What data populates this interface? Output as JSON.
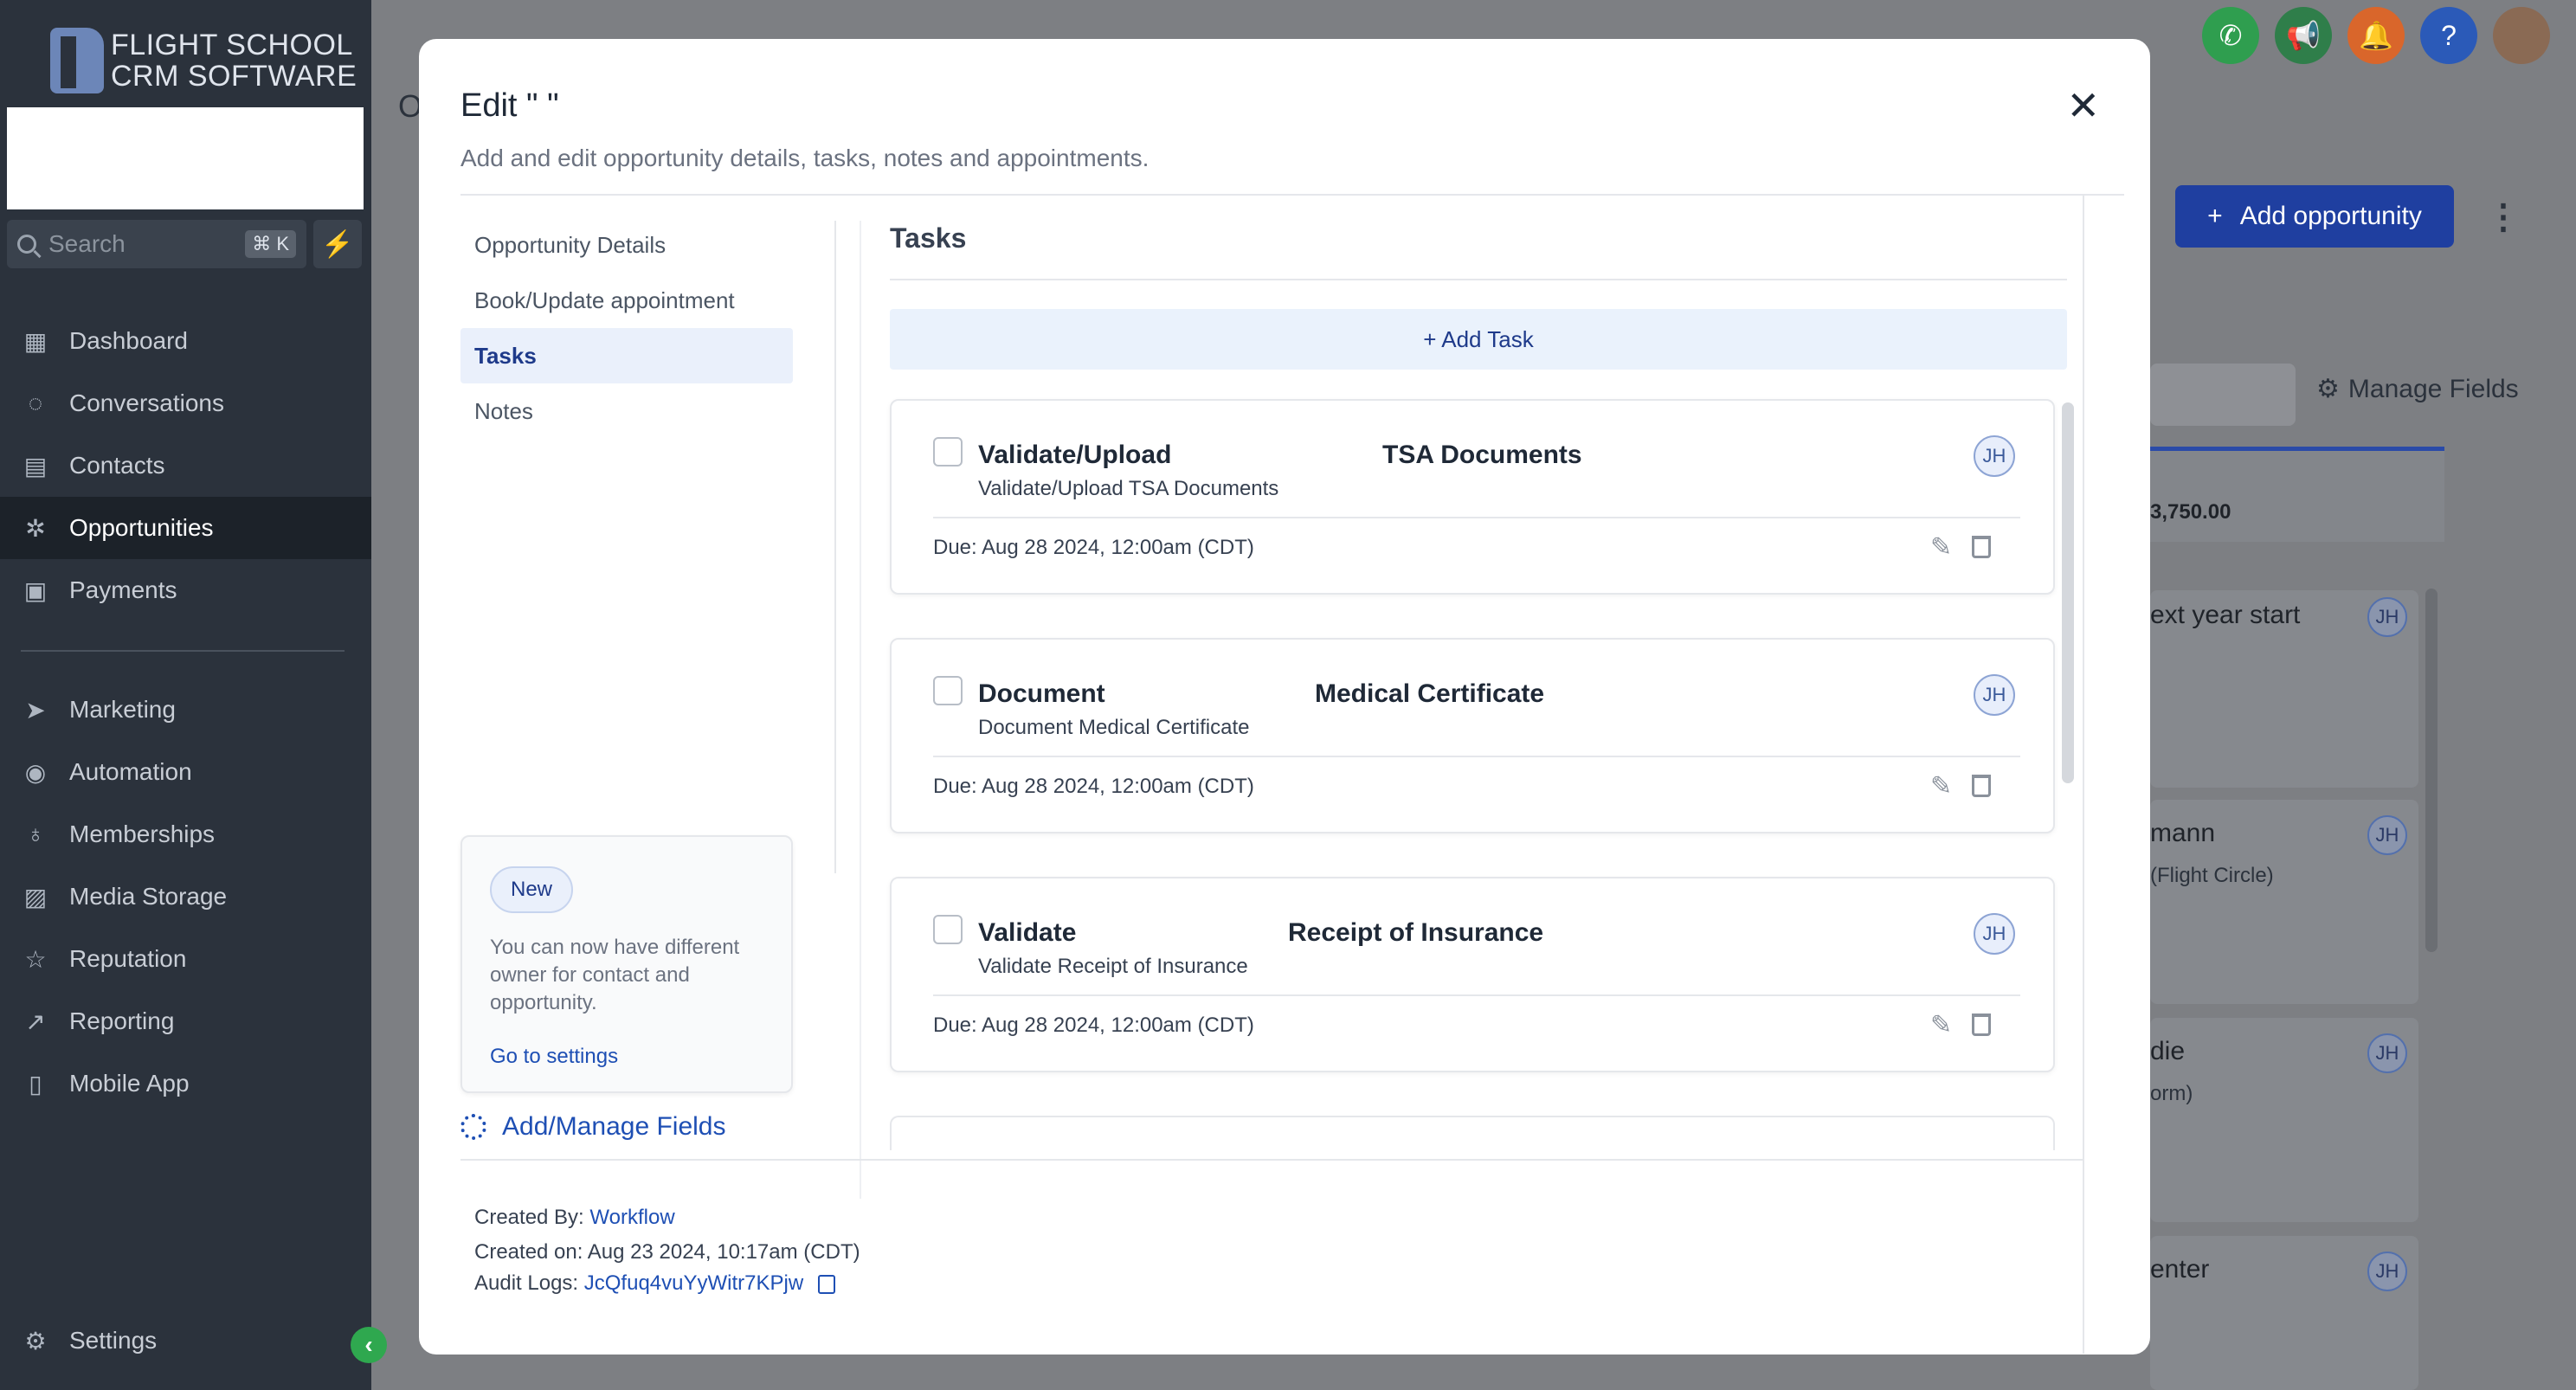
{
  "sidebar": {
    "logo_line1": "FLIGHT SCHOOL",
    "logo_line2": "CRM SOFTWARE",
    "search_placeholder": "Search",
    "search_shortcut": "⌘ K",
    "items": [
      {
        "label": "Dashboard",
        "icon": "dashboard-icon",
        "glyph": "▦"
      },
      {
        "label": "Conversations",
        "icon": "chat-icon",
        "glyph": "◌"
      },
      {
        "label": "Contacts",
        "icon": "contacts-icon",
        "glyph": "▤"
      },
      {
        "label": "Opportunities",
        "icon": "opportunities-icon",
        "glyph": "✲"
      },
      {
        "label": "Payments",
        "icon": "payments-icon",
        "glyph": "▣"
      },
      {
        "label": "Marketing",
        "icon": "send-icon",
        "glyph": "➤"
      },
      {
        "label": "Automation",
        "icon": "automation-icon",
        "glyph": "◉"
      },
      {
        "label": "Memberships",
        "icon": "membership-icon",
        "glyph": "♁"
      },
      {
        "label": "Media Storage",
        "icon": "image-icon",
        "glyph": "▨"
      },
      {
        "label": "Reputation",
        "icon": "star-icon",
        "glyph": "☆"
      },
      {
        "label": "Reporting",
        "icon": "trend-icon",
        "glyph": "↗"
      },
      {
        "label": "Mobile App",
        "icon": "phone-icon",
        "glyph": "▯"
      }
    ],
    "settings_label": "Settings"
  },
  "background": {
    "title_fragment": "O",
    "add_opportunity_label": "Add opportunity",
    "manage_fields_label": "Manage Fields",
    "amount": "3,750.00",
    "cards": [
      {
        "title": "ext year start",
        "sub": ""
      },
      {
        "title": "mann",
        "sub": "(Flight Circle)"
      },
      {
        "title": "die",
        "sub": "orm)"
      },
      {
        "title": "enter",
        "sub": ""
      }
    ],
    "avatar_initials": "JH"
  },
  "modal": {
    "title": "Edit \"                              \"",
    "subtitle": "Add and edit opportunity details, tasks, notes and appointments.",
    "close_glyph": "✕",
    "nav": [
      {
        "label": "Opportunity Details",
        "active": false
      },
      {
        "label": "Book/Update appointment",
        "active": false
      },
      {
        "label": "Tasks",
        "active": true
      },
      {
        "label": "Notes",
        "active": false
      }
    ],
    "promo": {
      "badge": "New",
      "text": "You can now have different owner for contact and opportunity.",
      "link": "Go to settings"
    },
    "add_manage_fields": "Add/Manage Fields",
    "tasks_heading": "Tasks",
    "add_task_label": "+ Add Task",
    "tasks": [
      {
        "title": "Validate/Upload",
        "title2": "TSA Documents",
        "desc": "Validate/Upload TSA Documents",
        "due": "Due: Aug 28 2024, 12:00am (CDT)",
        "assignee": "JH"
      },
      {
        "title": "Document",
        "title2": "Medical Certificate",
        "desc": "Document Medical Certificate",
        "due": "Due: Aug 28 2024, 12:00am (CDT)",
        "assignee": "JH"
      },
      {
        "title": "Validate",
        "title2": "Receipt of Insurance",
        "desc": "Validate Receipt of Insurance",
        "due": "Due: Aug 28 2024, 12:00am (CDT)",
        "assignee": "JH"
      }
    ],
    "footer": {
      "created_by_label": "Created By:",
      "created_by_value": "Workflow",
      "created_on": "Created on: Aug 23 2024, 10:17am (CDT)",
      "audit_label": "Audit Logs:",
      "audit_value": "JcQfuq4vuYyWitr7KPjw"
    }
  },
  "colors": {
    "sidebar_bg": "#2b323c",
    "primary": "#1f3fa0",
    "link": "#1e4fb4",
    "green": "#2fa84f"
  }
}
